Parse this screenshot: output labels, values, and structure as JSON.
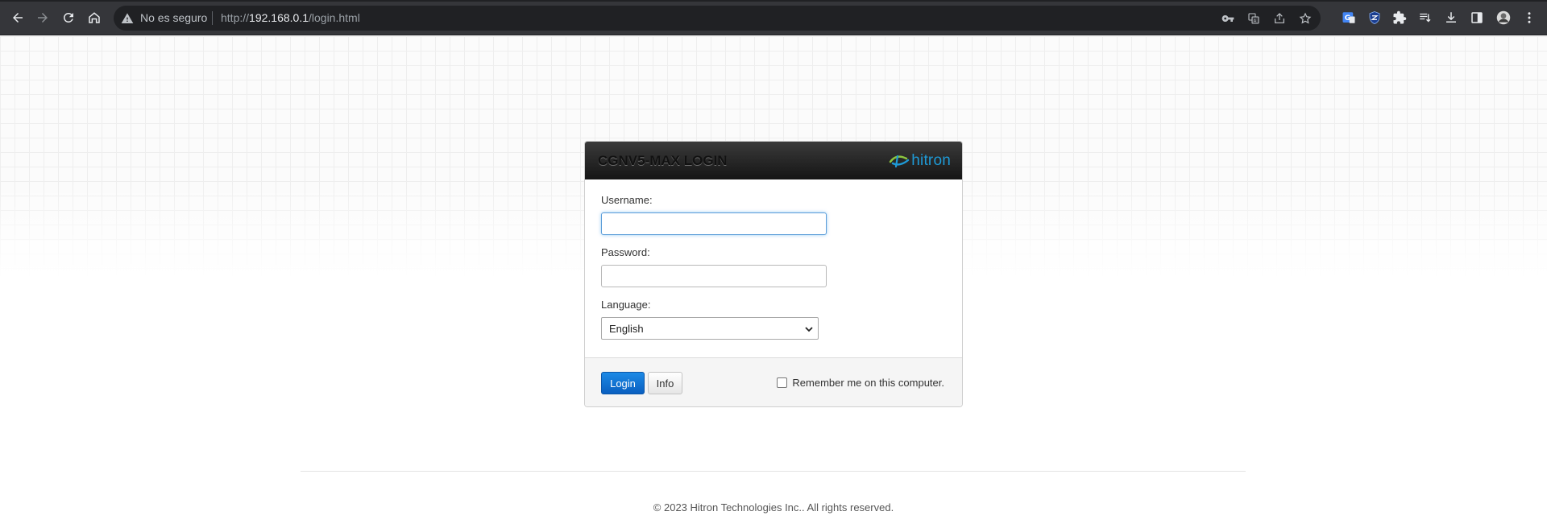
{
  "browser": {
    "security_label": "No es seguro",
    "url_prefix": "http://",
    "url_host": "192.168.0.1",
    "url_path": "/login.html",
    "icons": [
      "back-icon",
      "forward-icon",
      "reload-icon",
      "home-icon",
      "warning-icon",
      "key-icon",
      "translate-icon",
      "share-icon",
      "star-icon",
      "google-translate-extension-icon",
      "shield-extension-icon",
      "extensions-puzzle-icon",
      "reading-list-icon",
      "download-icon",
      "side-panel-icon",
      "profile-avatar",
      "menu-icon"
    ]
  },
  "login": {
    "title": "CGNV5-MAX LOGIN",
    "logo_text": "hitron",
    "username_label": "Username:",
    "username_value": "",
    "password_label": "Password:",
    "password_value": "",
    "language_label": "Language:",
    "language_selected": "English",
    "login_button": "Login",
    "info_button": "Info",
    "remember_label": "Remember me on this computer.",
    "remember_checked": false
  },
  "footer": {
    "copyright": "© 2023 Hitron Technologies Inc.. All rights reserved."
  },
  "colors": {
    "chrome_bg": "#35363a",
    "omnibox_bg": "#202124",
    "header_dark": "#151515",
    "login_button_blue": "#0a6cd6",
    "logo_blue": "#1e9ad6",
    "logo_green": "#8cc63f"
  }
}
